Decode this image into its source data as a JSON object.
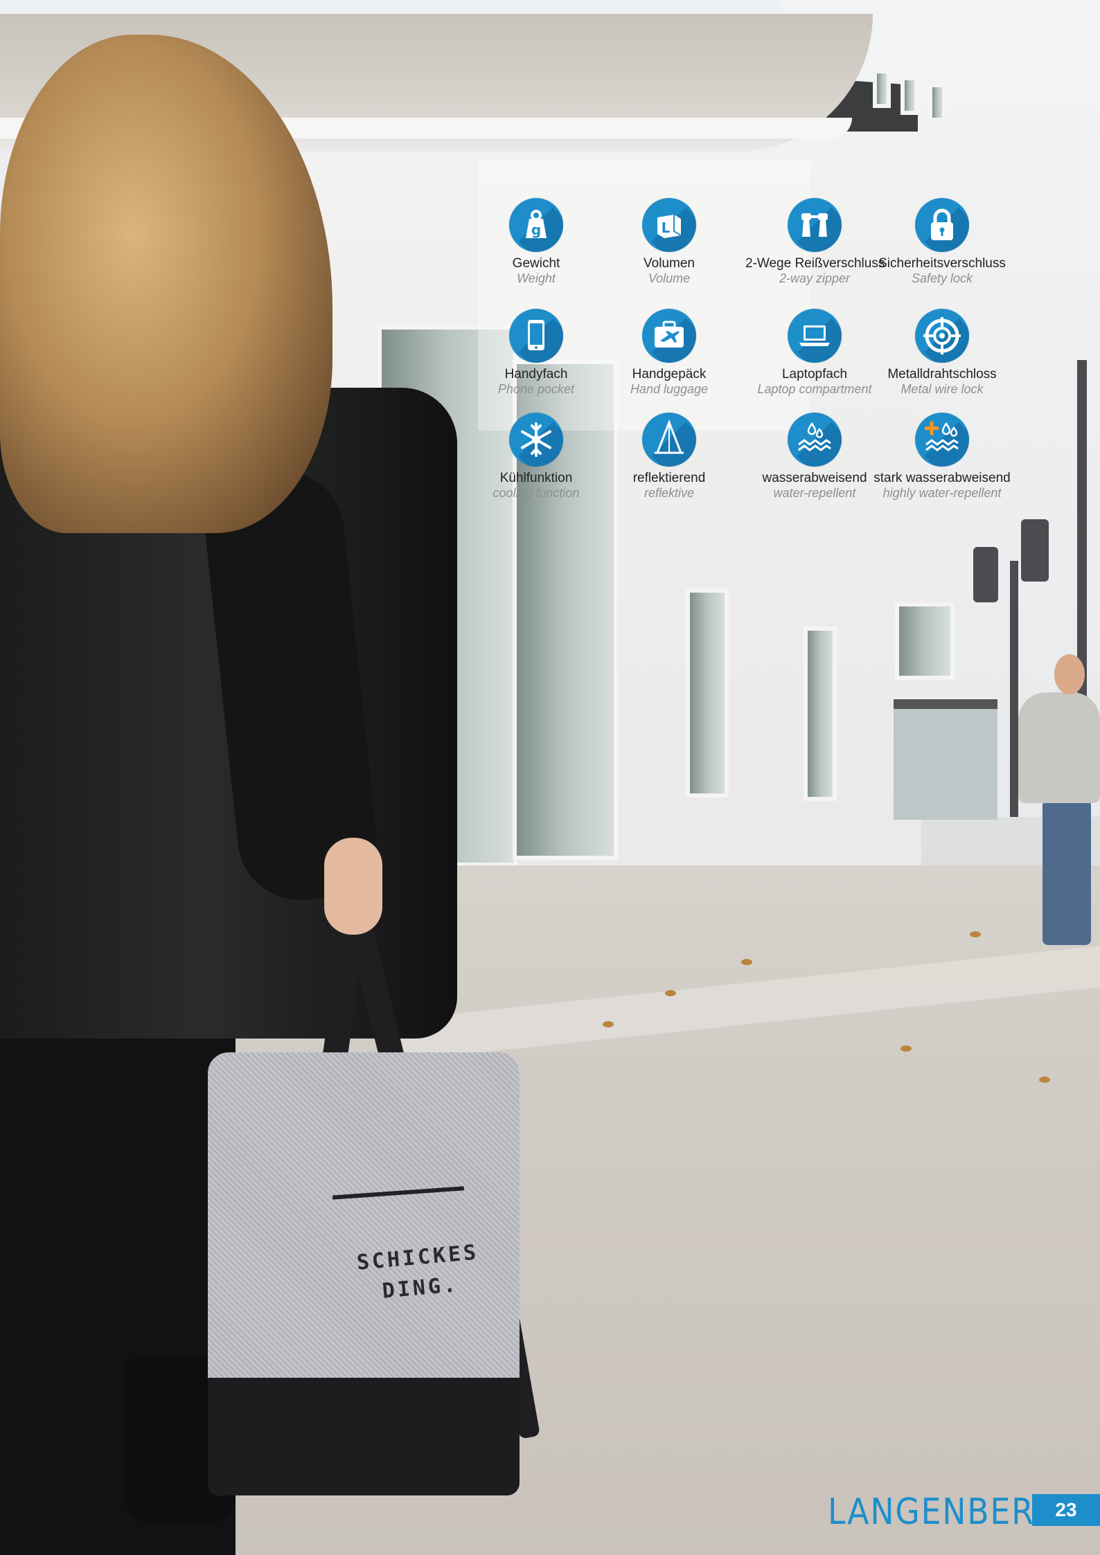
{
  "features": [
    {
      "icon": "weight-icon",
      "de": "Gewicht",
      "en": "Weight"
    },
    {
      "icon": "volume-icon",
      "de": "Volumen",
      "en": "Volume"
    },
    {
      "icon": "two-way-zipper-icon",
      "de": "2-Wege Reißverschluss",
      "en": "2-way zipper"
    },
    {
      "icon": "safety-lock-icon",
      "de": "Sicherheitsverschluss",
      "en": "Safety lock"
    },
    {
      "icon": "phone-pocket-icon",
      "de": "Handyfach",
      "en": "Phone pocket"
    },
    {
      "icon": "hand-luggage-icon",
      "de": "Handgepäck",
      "en": "Hand luggage"
    },
    {
      "icon": "laptop-compartment-icon",
      "de": "Laptopfach",
      "en": "Laptop compartment"
    },
    {
      "icon": "metal-wire-lock-icon",
      "de": "Metalldrahtschloss",
      "en": "Metal wire lock"
    },
    {
      "icon": "cooling-function-icon",
      "de": "Kühlfunktion",
      "en": "cooling function"
    },
    {
      "icon": "reflective-icon",
      "de": "reflektierend",
      "en": "reflektive"
    },
    {
      "icon": "water-repellent-icon",
      "de": "wasserabweisend",
      "en": "water-repellent"
    },
    {
      "icon": "highly-water-repellent-icon",
      "de": "stark wasserabweisend",
      "en": "highly water-repellent"
    }
  ],
  "icon_glyphs": {
    "weight": "g",
    "volume": "L"
  },
  "photo": {
    "bag_print": "SCHICKES\nDING."
  },
  "footer": {
    "brand": "LANGENBERG",
    "page_number": "23"
  },
  "colors": {
    "accent": "#1e8ecb",
    "caption_en": "#8d8f92"
  }
}
